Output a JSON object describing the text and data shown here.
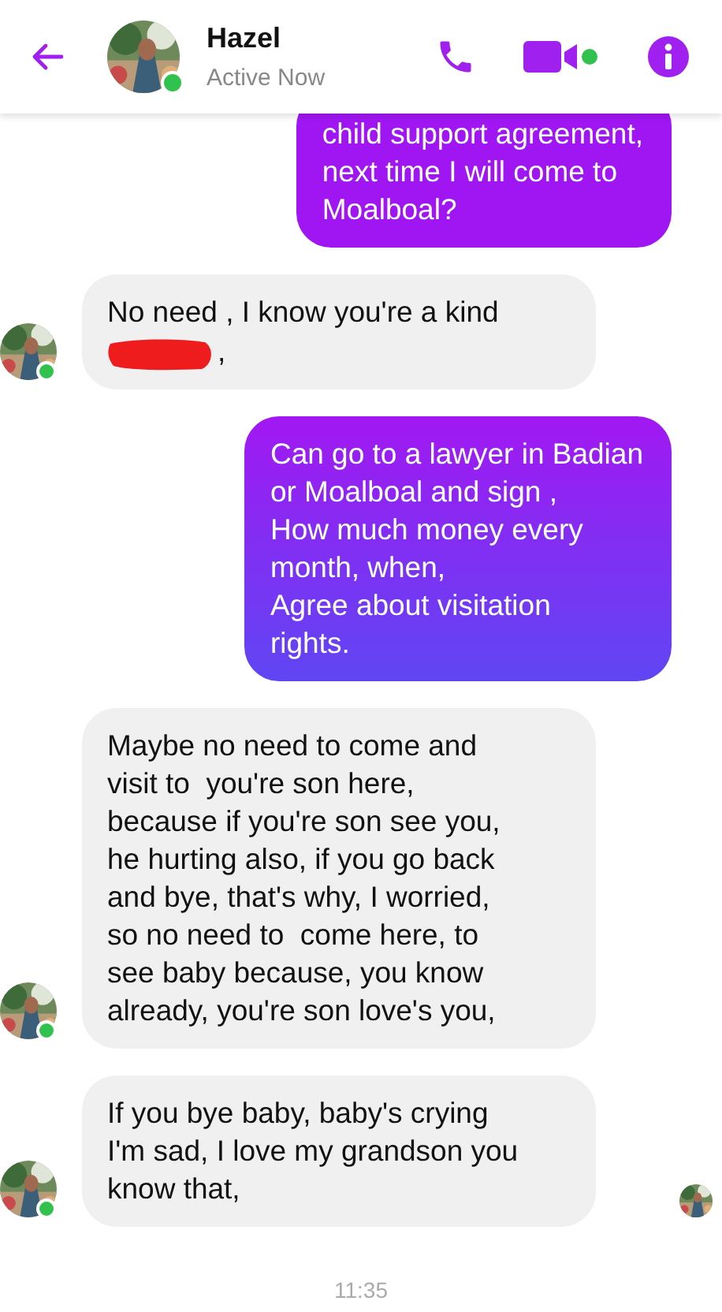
{
  "header": {
    "name": "Hazel",
    "status": "Active Now",
    "online": true,
    "video_active": true
  },
  "messages": [
    {
      "kind": "sent",
      "text": "child support agreement,\nnext time I will come to\nMoalboal?",
      "clipped": true
    },
    {
      "kind": "received",
      "text": "No need , I know you're a kind",
      "redaction": true,
      "after_redaction": ",",
      "avatar": true,
      "online": true
    },
    {
      "kind": "sent",
      "text": "Can go to a lawyer in Badian\nor Moalboal and sign ,\nHow much money every\nmonth, when,\nAgree about visitation\nrights."
    },
    {
      "kind": "received",
      "text": "Maybe no need to come and\nvisit to  you're son here,\nbecause if you're son see you,\nhe hurting also, if you go back\nand bye, that's why, I worried,\nso no need to  come here, to\nsee baby because, you know\nalready, you're son love's you,",
      "avatar": true,
      "online": true
    },
    {
      "kind": "received",
      "text": "If you bye baby, baby's crying\nI'm sad, I love my grandson you\nknow that,",
      "avatar": true,
      "online": true,
      "seen": true
    }
  ],
  "time": "11:35"
}
